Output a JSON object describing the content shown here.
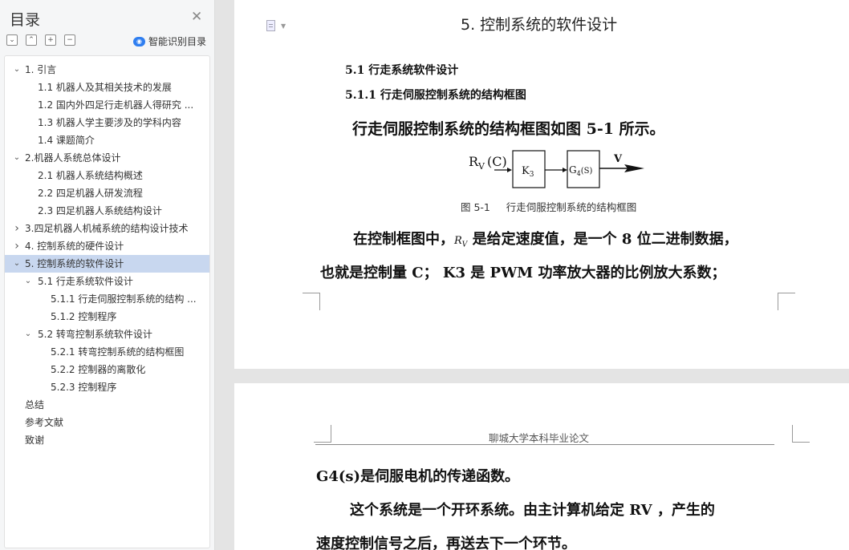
{
  "sidebar": {
    "title": "目录",
    "close_icon": "close-icon",
    "tools": [
      {
        "name": "collapse-all",
        "glyph": "⌄"
      },
      {
        "name": "expand-all",
        "glyph": "⌃"
      },
      {
        "name": "add-level",
        "glyph": "+"
      },
      {
        "name": "remove-level",
        "glyph": "−"
      }
    ],
    "smart_toc": {
      "label": "智能识别目录",
      "icon": "smart-icon",
      "icon_glyph": "◉"
    },
    "toc": [
      {
        "text": "1. 引言",
        "level": 0,
        "arrow": "expanded"
      },
      {
        "text": "1.1 机器人及其相关技术的发展",
        "level": 1,
        "arrow": "none"
      },
      {
        "text": "1.2 国内外四足行走机器人得研究 ...",
        "level": 1,
        "arrow": "none"
      },
      {
        "text": "1.3 机器人学主要涉及的学科内容",
        "level": 1,
        "arrow": "none"
      },
      {
        "text": "1.4  课题简介",
        "level": 1,
        "arrow": "none"
      },
      {
        "text": "2.机器人系统总体设计",
        "level": 0,
        "arrow": "expanded"
      },
      {
        "text": "2.1 机器人系统结构概述",
        "level": 1,
        "arrow": "none"
      },
      {
        "text": "2.2  四足机器人研发流程",
        "level": 1,
        "arrow": "none"
      },
      {
        "text": "2.3 四足机器人系统结构设计",
        "level": 1,
        "arrow": "none"
      },
      {
        "text": "3.四足机器人机械系统的结构设计技术",
        "level": 0,
        "arrow": "collapsed"
      },
      {
        "text": "4. 控制系统的硬件设计",
        "level": 0,
        "arrow": "collapsed"
      },
      {
        "text": "5. 控制系统的软件设计",
        "level": 0,
        "arrow": "expanded",
        "active": true
      },
      {
        "text": "5.1  行走系统软件设计",
        "level": 1,
        "arrow": "expanded"
      },
      {
        "text": "5.1.1    行走伺服控制系统的结构 ...",
        "level": 2,
        "arrow": "none"
      },
      {
        "text": "5.1.2 控制程序",
        "level": 2,
        "arrow": "none"
      },
      {
        "text": "5.2 转弯控制系统软件设计",
        "level": 1,
        "arrow": "expanded"
      },
      {
        "text": "5.2.1 转弯控制系统的结构框图",
        "level": 2,
        "arrow": "none"
      },
      {
        "text": "5.2.2  控制器的离散化",
        "level": 2,
        "arrow": "none"
      },
      {
        "text": "5.2.3  控制程序",
        "level": 2,
        "arrow": "none"
      },
      {
        "text": "总结",
        "level": -1,
        "arrow": "none"
      },
      {
        "text": "参考文献",
        "level": -1,
        "arrow": "none"
      },
      {
        "text": "致谢",
        "level": -1,
        "arrow": "none"
      }
    ]
  },
  "page1": {
    "chapter_title": "5. 控制系统的软件设计",
    "h2": "5.1  行走系统软件设计",
    "h3": "5.1.1    行走伺服控制系统的结构框图",
    "para1": "行走伺服控制系统的结构框图如图 5-1 所示。",
    "diagram": {
      "input": "R",
      "input_sub": "V",
      "input_paren": "(C)",
      "block1": "K",
      "block1_sub": "3",
      "block2": "G",
      "block2_sub": "4",
      "block2_paren": "(S)",
      "output": "V"
    },
    "fig_caption": "图 5-1     行走伺服控制系统的结构框图",
    "para2_pre": "在控制框图中，",
    "para2_rv": "R",
    "para2_rv_sub": "V",
    "para2_post": " 是给定速度值，是一个 8 位二进制数据，",
    "para3": "也就是控制量 C；  K3 是 PWM 功率放大器的比例放大系数；"
  },
  "page2": {
    "header": "聊城大学本科毕业论文",
    "line1": "G4(s)是伺服电机的传递函数。",
    "line2": "这个系统是一个开环系统。由主计算机给定 RV ，产生的",
    "line3": "速度控制信号之后，再送去下一个环节。"
  },
  "colors": {
    "active_toc": "#c8d7ef",
    "smart_icon": "#2f7ef0",
    "sidebar_bg": "#f5f6f7",
    "canvas_bg": "#e4e4e4"
  }
}
